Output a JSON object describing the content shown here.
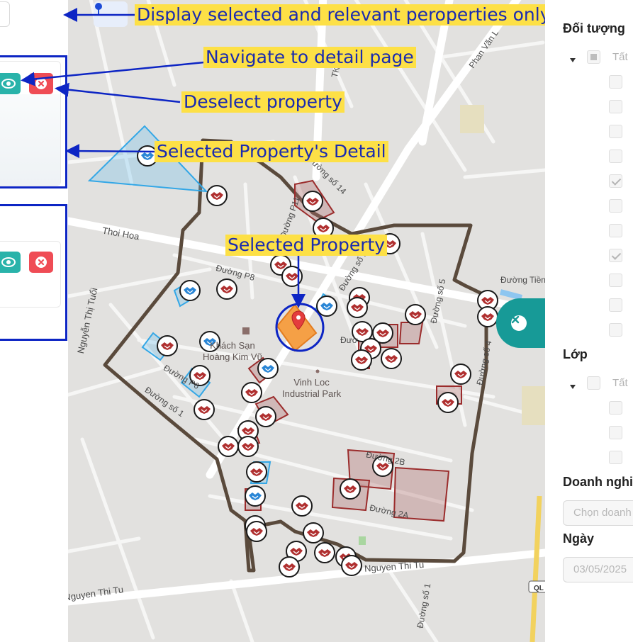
{
  "annotations": {
    "display_selected": "Display selected and relevant peroperties only",
    "navigate_detail": "Navigate to detail page",
    "deselect": "Deselect property",
    "selected_detail": "Selected Property's Detail",
    "selected_property": "Selected Property"
  },
  "map": {
    "streets": {
      "thoi_hoa": "Thoi Hoa",
      "nguyen_thi_tuoi": "Nguyễn Thị Tuổi",
      "duong_p8": "Đường P8",
      "duong_p11": "Đường P11",
      "duong_so_14": "Đường số 14",
      "duong_so_2": "Đường số 2",
      "duong_so_5": "Đường số 5",
      "duong_so_4": "Đường số 4",
      "duong_tien": "Đường Tiền",
      "phan_van": "Phan Văn L",
      "tk1": "TK 1",
      "duong_p6": "Đường P6",
      "duong_so_1": "Đường số 1",
      "duong_2b": "Đường 2B",
      "duong_2a": "Đường 2A",
      "duong_partial": "Đườ",
      "nguyen_thi_tu_top": "Nguyen Thi Tu",
      "nguyen_thi_tu_bottom": "Nguyen Thi Tu",
      "duong_so_1_bottom": "Đường số 1",
      "ql_badge": "QL"
    },
    "pois": {
      "hotel_line1": "Khách Sạn",
      "hotel_line2": "Hoàng Kim Vũ",
      "park_line1": "Vinh Loc",
      "park_line2": "Industrial Park"
    }
  },
  "filters": {
    "object_title": "Đối tượng",
    "object_all_label": "Tất",
    "object_items_checked": [
      false,
      false,
      false,
      false,
      true,
      false,
      false,
      true,
      false,
      false,
      false
    ],
    "layer_title": "Lớp",
    "layer_all_label": "Tất",
    "layer_items_checked": [
      false,
      false,
      false
    ],
    "business_title": "Doanh nghi",
    "business_placeholder": "Chọn doanh",
    "date_title": "Ngày",
    "date_value": "03/05/2025"
  },
  "colors": {
    "frame_blue": "#0d25c4",
    "annotation_yellow": "#fde046",
    "eye_button": "#29b3aa",
    "deselect_button": "#ef4c55",
    "boundary": "#5a4a3c",
    "property_red": "#9b2c2c",
    "selected_orange": "#f5a046"
  }
}
